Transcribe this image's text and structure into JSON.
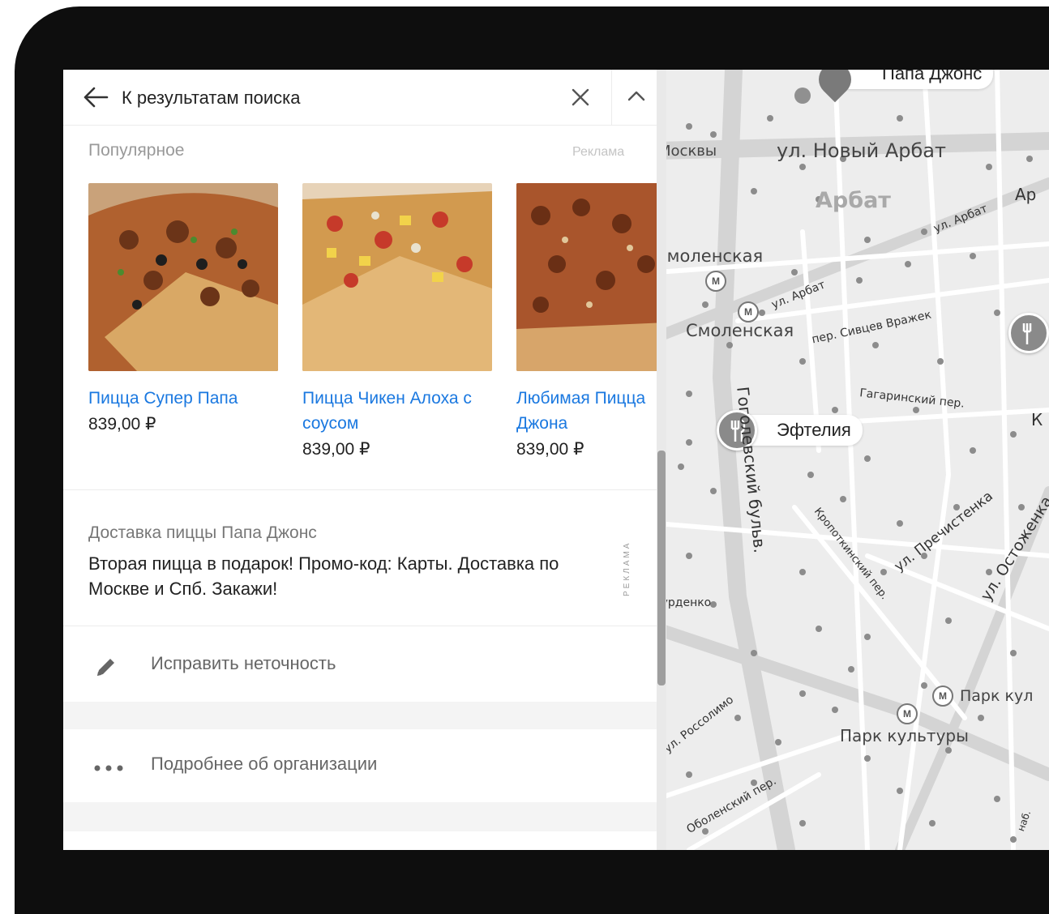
{
  "header": {
    "back_label": "К результатам поиска"
  },
  "popular": {
    "title": "Популярное",
    "ad_label": "Реклама",
    "items": [
      {
        "name": "Пицца Супер Папа",
        "price": "839,00 ₽"
      },
      {
        "name": "Пицца Чикен Алоха с соусом",
        "price": "839,00 ₽"
      },
      {
        "name": "Любимая Пицца Джона",
        "price": "839,00 ₽"
      }
    ]
  },
  "promo": {
    "title": "Доставка пиццы Папа Джонс",
    "text": "Вторая пицца в подарок! Промо-код: Карты. Доставка по Москве и Спб. Закажи!",
    "ad_label": "РЕКЛАМА"
  },
  "actions": [
    {
      "label": "Исправить неточность",
      "icon": "pencil-icon"
    },
    {
      "label": "Подробнее об организации",
      "icon": "more-dots-icon"
    }
  ],
  "map": {
    "pins": [
      "Папа Джонс",
      "Эфтелия"
    ],
    "labels": {
      "novy_arbat": "ул. Новый Арбат",
      "arbat": "Арбат",
      "moskvy": "Москвы",
      "smolenskaya1": "Смоленская",
      "smolenskaya2": "Смоленская",
      "ul_arbat1": "ул. Арбат",
      "ul_arbat2": "ул. Арбат",
      "ar": "Ар",
      "sivtsev": "пер. Сивцев Вражек",
      "gagarinsky": "Гагаринский пер.",
      "k": "К",
      "gogolevsky": "Гоголевский бульв.",
      "prechistenka": "ул. Пречистенка",
      "ostozhenka": "ул. Остоженка",
      "kropotkinsky": "Кропоткинский пер.",
      "burdenko": "Бурденко",
      "rossolimo": "ул. Россолимо",
      "park_kul_short": "Парк кул",
      "park_kultury": "Парк культуры",
      "obolensky": "Оболенский пер.",
      "nab": "наб."
    }
  }
}
